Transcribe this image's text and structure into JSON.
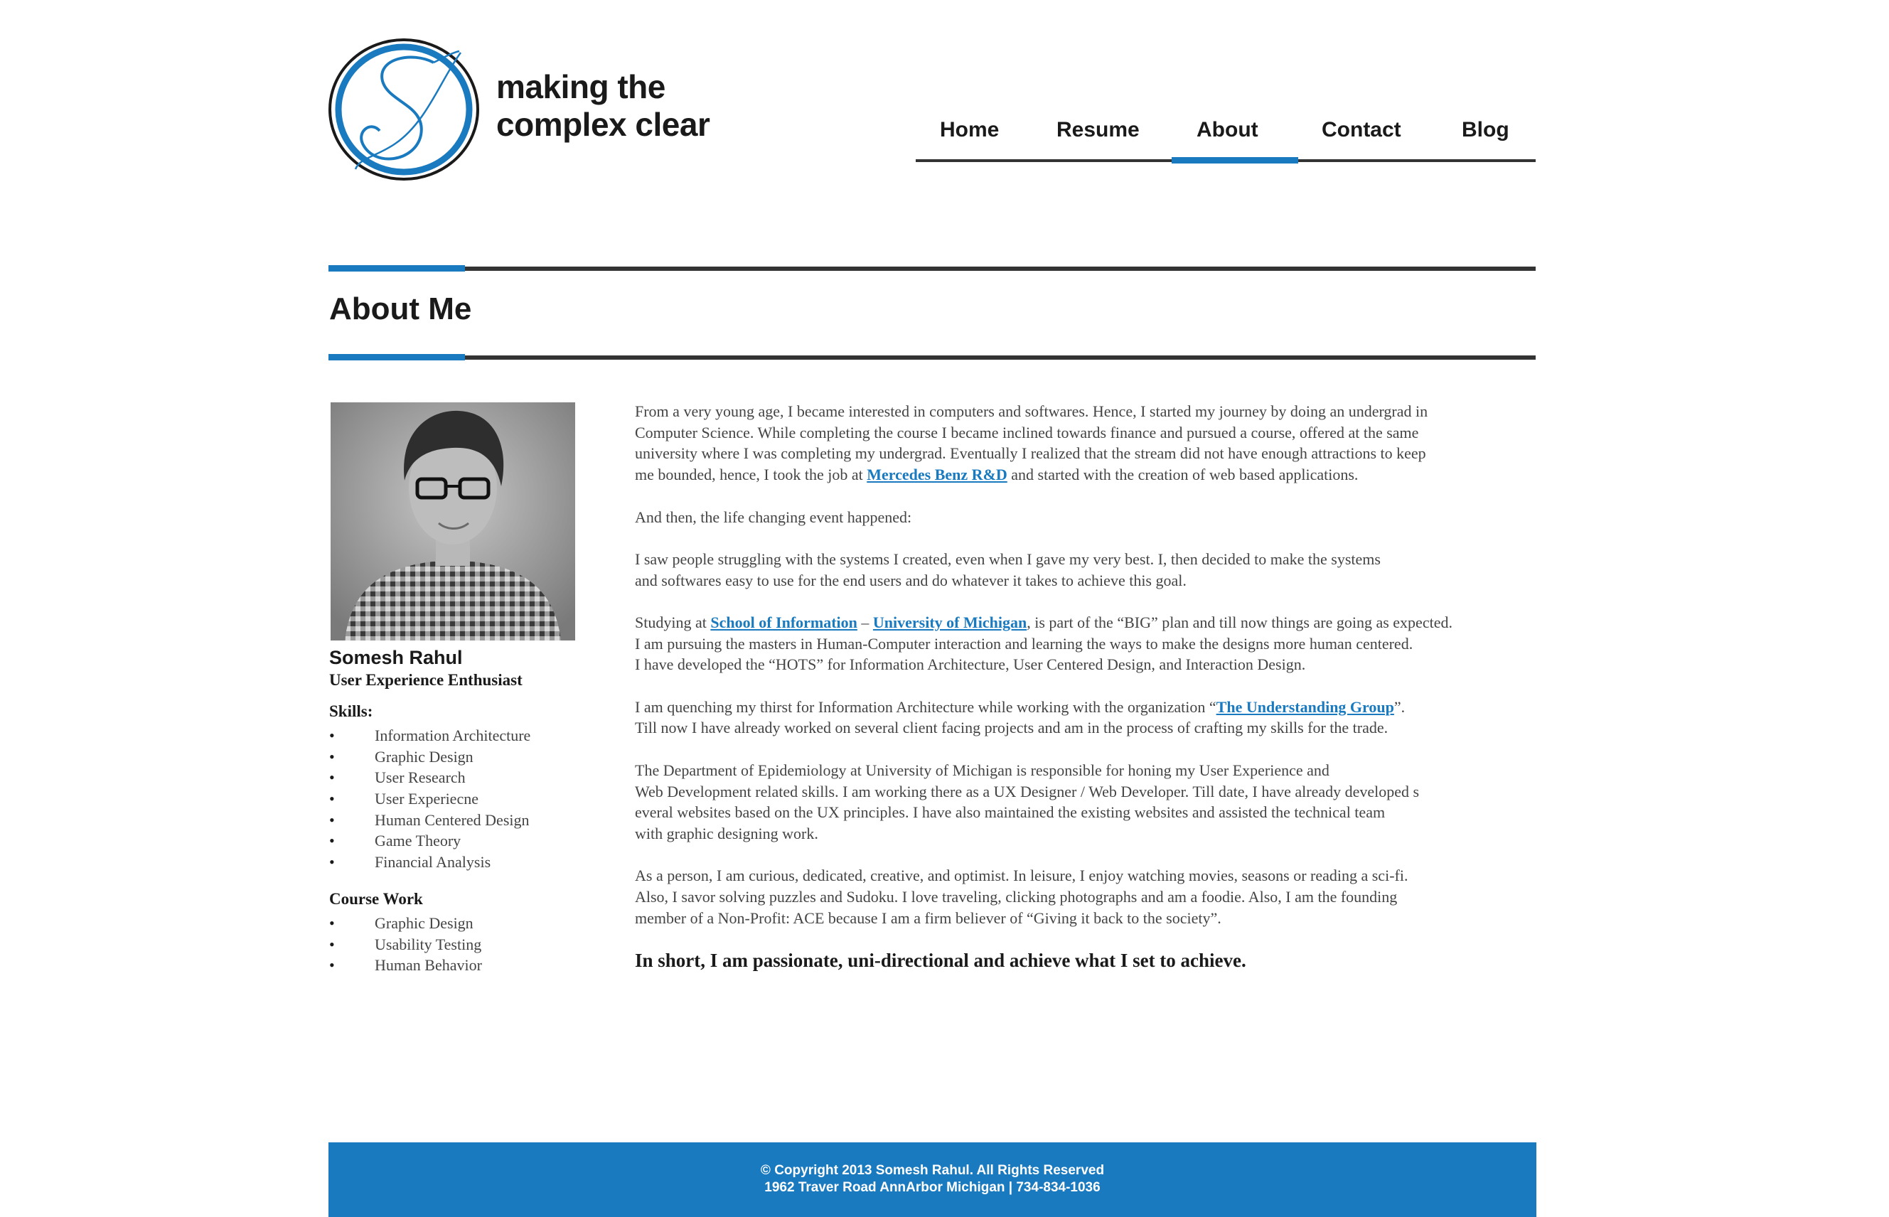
{
  "brand": {
    "tagline_line1": "making the",
    "tagline_line2": "complex clear",
    "monogram": "S",
    "accent_color": "#1a7abf"
  },
  "nav": {
    "items": [
      {
        "label": "Home"
      },
      {
        "label": "Resume"
      },
      {
        "label": "About"
      },
      {
        "label": "Contact"
      },
      {
        "label": "Blog"
      }
    ],
    "active": "About"
  },
  "page": {
    "title": "About Me"
  },
  "profile": {
    "name": "Somesh Rahul",
    "role": "User Experience Enthusiast",
    "skills_heading": "Skills:",
    "skills": [
      "Information Architecture",
      "Graphic Design",
      "User Research",
      "User Experiecne",
      "Human Centered Design",
      "Game Theory",
      "Financial Analysis"
    ],
    "coursework_heading": "Course Work",
    "coursework": [
      "Graphic Design",
      "Usability Testing",
      "Human Behavior"
    ],
    "bullet": "•"
  },
  "content": {
    "p1": {
      "l1": "From a very young age, I became interested in computers and softwares. Hence, I started my journey by doing an undergrad in",
      "l2": "Computer Science. While completing the course I became inclined towards finance and pursued a course, offered at the same",
      "l3": "university where I was completing my undergrad. Eventually I realized that the stream did not have enough attractions to keep",
      "l4_pre": "me bounded, hence, I took the job at ",
      "l4_link": "Mercedes Benz R&D",
      "l4_post": " and started with the creation of web based applications."
    },
    "p2": "And then, the life changing event happened:",
    "p3": {
      "l1": "I saw people struggling with the systems I created, even when I gave my very best. I, then decided to make the systems",
      "l2": "and softwares easy to use for the end users and do whatever it takes to achieve this goal."
    },
    "p4": {
      "l1_pre": "Studying at ",
      "l1_link1": "School of Information",
      "l1_sep": " – ",
      "l1_link2": "University of Michigan",
      "l1_post": ", is part of the “BIG” plan and till now things are going as expected.",
      "l2": "I am pursuing the masters in Human-Computer interaction and learning the ways to make the designs more human centered.",
      "l3": "I have developed the “HOTS” for Information Architecture, User Centered Design, and Interaction Design."
    },
    "p5": {
      "l1_pre": "I am quenching my thirst for Information Architecture while working with the organization “",
      "l1_link": "The Understanding Group",
      "l1_post": "”.",
      "l2": "Till now I have already worked on several client facing projects and am in the process of crafting my skills for the trade."
    },
    "p6": {
      "l1": "The Department of Epidemiology at University of Michigan is responsible for honing my User Experience and",
      "l2": "Web Development related skills. I am working there as a UX Designer / Web Developer. Till date, I have already developed s",
      "l3": "everal websites based on the UX principles. I have also maintained the existing websites and assisted the technical team",
      "l4": "with graphic designing work."
    },
    "p7": {
      "l1": "As a person, I am curious, dedicated, creative, and optimist. In leisure, I enjoy watching movies, seasons or reading a sci-fi.",
      "l2": "Also, I savor solving puzzles and Sudoku. I love traveling, clicking photographs and am a foodie. Also, I am the founding",
      "l3": "member of a Non-Profit: ACE because I am a firm believer of “Giving it back to the society”."
    },
    "summary": "In short, I am passionate, uni-directional and achieve what I set to achieve."
  },
  "footer": {
    "copyright": "© Copyright 2013 Somesh Rahul. All Rights Reserved",
    "address": "1962 Traver Road AnnArbor Michigan | 734-834-1036"
  }
}
